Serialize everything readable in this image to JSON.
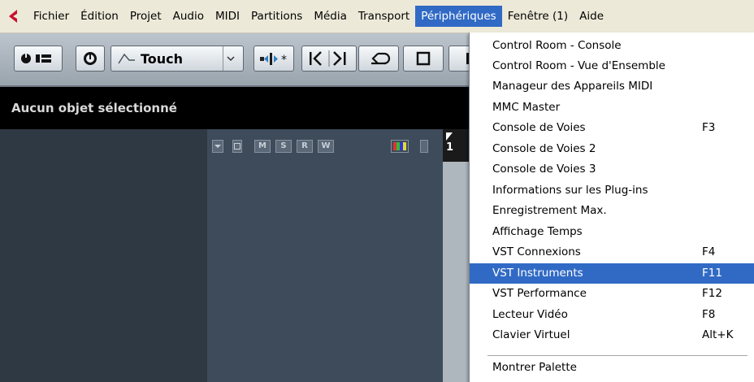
{
  "menubar": {
    "items": [
      {
        "label": "Fichier"
      },
      {
        "label": "Édition"
      },
      {
        "label": "Projet"
      },
      {
        "label": "Audio"
      },
      {
        "label": "MIDI"
      },
      {
        "label": "Partitions"
      },
      {
        "label": "Média"
      },
      {
        "label": "Transport"
      },
      {
        "label": "Périphériques",
        "active": true
      },
      {
        "label": "Fenêtre (1)"
      },
      {
        "label": "Aide"
      }
    ]
  },
  "toolbar": {
    "automation_mode": "Touch"
  },
  "info_line": {
    "text": "Aucun objet sélectionné"
  },
  "track_tools": {
    "m": "M",
    "s": "S",
    "r": "R",
    "w": "W"
  },
  "ruler": {
    "bar": "1"
  },
  "devices_menu": {
    "items": [
      {
        "label": "Control Room - Console",
        "shortcut": ""
      },
      {
        "label": "Control Room - Vue d'Ensemble",
        "shortcut": ""
      },
      {
        "label": "Manageur des Appareils MIDI",
        "shortcut": ""
      },
      {
        "label": "MMC Master",
        "shortcut": ""
      },
      {
        "label": "Console de Voies",
        "shortcut": "F3"
      },
      {
        "label": "Console de Voies 2",
        "shortcut": ""
      },
      {
        "label": "Console de Voies 3",
        "shortcut": ""
      },
      {
        "label": "Informations sur les Plug-ins",
        "shortcut": ""
      },
      {
        "label": "Enregistrement Max.",
        "shortcut": ""
      },
      {
        "label": "Affichage Temps",
        "shortcut": ""
      },
      {
        "label": "VST Connexions",
        "shortcut": "F4"
      },
      {
        "label": "VST Instruments",
        "shortcut": "F11",
        "highlighted": true
      },
      {
        "label": "VST Performance",
        "shortcut": "F12"
      },
      {
        "label": "Lecteur Vidéo",
        "shortcut": "F8"
      },
      {
        "label": "Clavier Virtuel",
        "shortcut": "Alt+K"
      }
    ],
    "footer": {
      "label": "Montrer Palette"
    }
  },
  "colors": {
    "highlight": "#316ac5",
    "menubar_bg": "#ece9d8",
    "info_bg": "#000000"
  }
}
